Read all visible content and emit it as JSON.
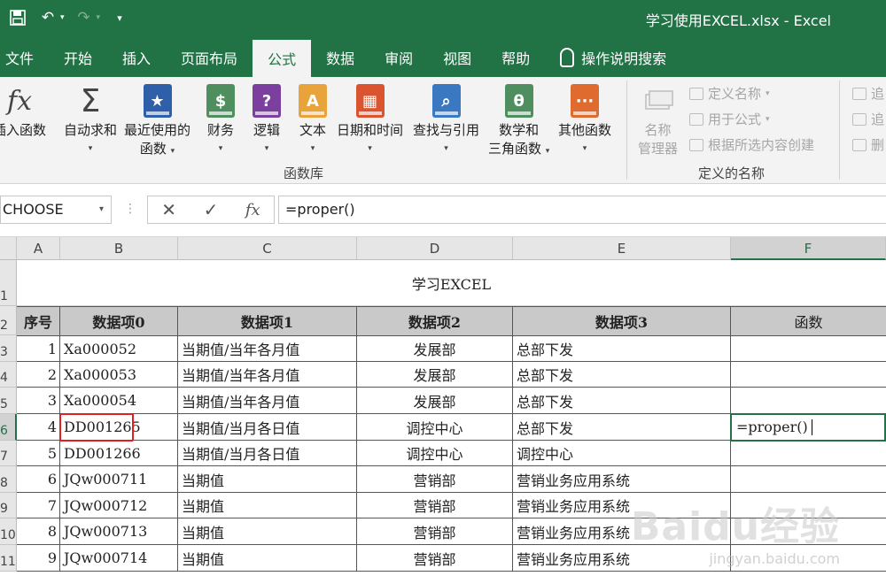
{
  "window": {
    "title": "学习使用EXCEL.xlsx  -  Excel"
  },
  "quick_access": {
    "save": "save-icon",
    "undo": "undo-icon",
    "redo": "redo-icon",
    "customize": "customize-icon"
  },
  "tabs": [
    "文件",
    "开始",
    "插入",
    "页面布局",
    "公式",
    "数据",
    "审阅",
    "视图",
    "帮助",
    "操作说明搜索"
  ],
  "active_tab": "公式",
  "ribbon": {
    "function_library": {
      "label": "函数库",
      "insert_function": "插入函数",
      "autosum": "自动求和",
      "recent_1": "最近使用的",
      "recent_2": "函数",
      "financial": "财务",
      "logical": "逻辑",
      "text": "文本",
      "datetime": "日期和时间",
      "lookup": "查找与引用",
      "math_1": "数学和",
      "math_2": "三角函数",
      "other": "其他函数"
    },
    "defined_names": {
      "label": "定义的名称",
      "name_manager_1": "名称",
      "name_manager_2": "管理器",
      "define_name": "定义名称",
      "use_in_formula": "用于公式",
      "create_from_selection": "根据所选内容创建"
    },
    "formula_auditing": {
      "trace_precedents": "追",
      "trace_dependents": "追",
      "remove_arrows": "删"
    }
  },
  "formula_bar": {
    "name_box": "CHOOSE",
    "formula": "=proper()",
    "fx": "fx"
  },
  "columns": [
    "A",
    "B",
    "C",
    "D",
    "E",
    "F"
  ],
  "rows": [
    "1",
    "2",
    "3",
    "4",
    "5",
    "6",
    "7",
    "8",
    "9",
    "10",
    "11"
  ],
  "sheet": {
    "title": "学习EXCEL",
    "headers": [
      "序号",
      "数据项0",
      "数据项1",
      "数据项2",
      "数据项3",
      "函数"
    ],
    "data": [
      [
        "1",
        "Xa000052",
        "当期值/当年各月值",
        "发展部",
        "总部下发",
        ""
      ],
      [
        "2",
        "Xa000053",
        "当期值/当年各月值",
        "发展部",
        "总部下发",
        ""
      ],
      [
        "3",
        "Xa000054",
        "当期值/当年各月值",
        "发展部",
        "总部下发",
        ""
      ],
      [
        "4",
        "DD001265",
        "当期值/当月各日值",
        "调控中心",
        "总部下发",
        "=proper()"
      ],
      [
        "5",
        "DD001266",
        "当期值/当月各日值",
        "调控中心",
        "调控中心",
        ""
      ],
      [
        "6",
        "JQw000711",
        "当期值",
        "营销部",
        "营销业务应用系统",
        ""
      ],
      [
        "7",
        "JQw000712",
        "当期值",
        "营销部",
        "营销业务应用系统",
        ""
      ],
      [
        "8",
        "JQw000713",
        "当期值",
        "营销部",
        "营销业务应用系统",
        ""
      ],
      [
        "9",
        "JQw000714",
        "当期值",
        "营销部",
        "营销业务应用系统",
        ""
      ]
    ]
  },
  "watermark": {
    "main": "Baidu经验",
    "sub": "jingyan.baidu.com"
  },
  "colors": {
    "excel_green": "#217346",
    "highlight_red": "#e02020",
    "header_gray": "#c9c9c9"
  }
}
